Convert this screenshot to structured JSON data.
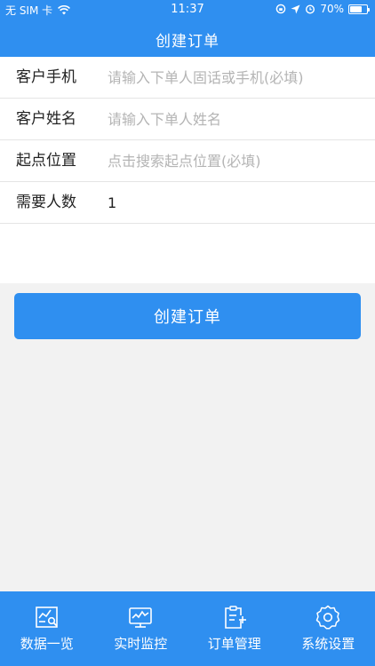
{
  "status_bar": {
    "carrier": "无 SIM 卡",
    "time": "11:37",
    "battery": "70%",
    "battery_level": 0.7
  },
  "nav": {
    "title": "创建订单"
  },
  "form": {
    "rows": [
      {
        "label": "客户手机",
        "value": "",
        "placeholder": "请输入下单人固话或手机(必填)"
      },
      {
        "label": "客户姓名",
        "value": "",
        "placeholder": "请输入下单人姓名"
      },
      {
        "label": "起点位置",
        "value": "",
        "placeholder": "点击搜索起点位置(必填)"
      },
      {
        "label": "需要人数",
        "value": "1",
        "placeholder": ""
      }
    ],
    "submit_label": "创建订单"
  },
  "tabbar": {
    "items": [
      {
        "label": "数据一览",
        "icon": "chart-search-icon"
      },
      {
        "label": "实时监控",
        "icon": "monitor-icon"
      },
      {
        "label": "订单管理",
        "icon": "clipboard-add-icon"
      },
      {
        "label": "系统设置",
        "icon": "gear-icon"
      }
    ]
  },
  "colors": {
    "primary": "#2f8ff0",
    "background": "#f2f2f2",
    "placeholder": "#b4b4b4"
  }
}
